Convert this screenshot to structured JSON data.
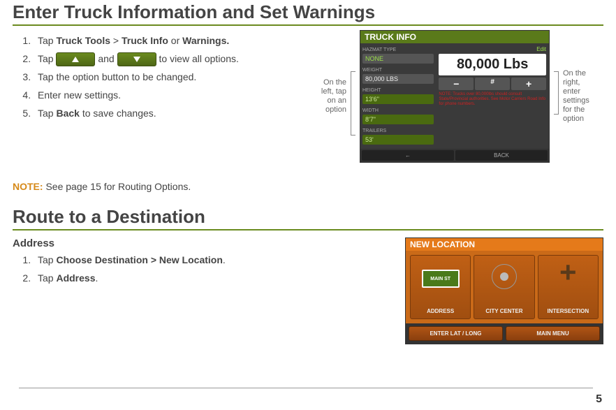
{
  "section1": {
    "heading": "Enter Truck Information and Set Warnings",
    "steps": [
      {
        "pre": "Tap ",
        "b1": "Truck Tools",
        "mid1": " > ",
        "b2": "Truck Info",
        "mid2": " or ",
        "b3": "Warnings."
      },
      {
        "pre": "Tap ",
        "mid": " and ",
        "post": " to view all options."
      },
      {
        "text": "Tap the option button to be changed."
      },
      {
        "text": "Enter new settings."
      },
      {
        "pre": "Tap ",
        "b1": "Back",
        "post": " to save changes."
      }
    ],
    "callout_left": {
      "l1": "On the",
      "l2": "left, tap",
      "l3": "on an",
      "l4": "option"
    },
    "callout_right": {
      "l1": "On the right,",
      "l2": "enter settings",
      "l3": "for the option"
    },
    "truck_screen": {
      "title": "TRUCK INFO",
      "hazmat_lab": "HAZMAT TYPE",
      "hazmat_val": "NONE",
      "weight_lab": "WEIGHT",
      "weight_val": "80,000 LBS",
      "height_lab": "HEIGHT",
      "height_val": "13'6\"",
      "width_lab": "WIDTH",
      "width_val": "8'7\"",
      "trailers_lab": "TRAILERS",
      "trailers_val": "53'",
      "edit": "Edit",
      "big": "80,000 Lbs",
      "minus": "−",
      "hash": "#",
      "plus": "+",
      "rednote": "NOTE: Trucks over 80,000lbs should consult State/Provincial authorities. See Motor Carriers Road Info for phone numbers.",
      "foot1": "←",
      "foot2": "BACK"
    },
    "note_label": "NOTE:",
    "note_text": " See page 15 for Routing Options."
  },
  "section2": {
    "heading": "Route to a Destination",
    "sub": "Address",
    "steps": [
      {
        "pre": "Tap ",
        "b1": "Choose Destination > New Location",
        "post": "."
      },
      {
        "pre": "Tap ",
        "b1": "Address",
        "post": "."
      }
    ],
    "loc_screen": {
      "title": "NEW LOCATION",
      "sign": "MAIN ST",
      "t1": "ADDRESS",
      "t2": "CITY CENTER",
      "t3": "INTERSECTION",
      "f1": "ENTER LAT / LONG",
      "f2": "MAIN MENU"
    }
  },
  "page_number": "5"
}
